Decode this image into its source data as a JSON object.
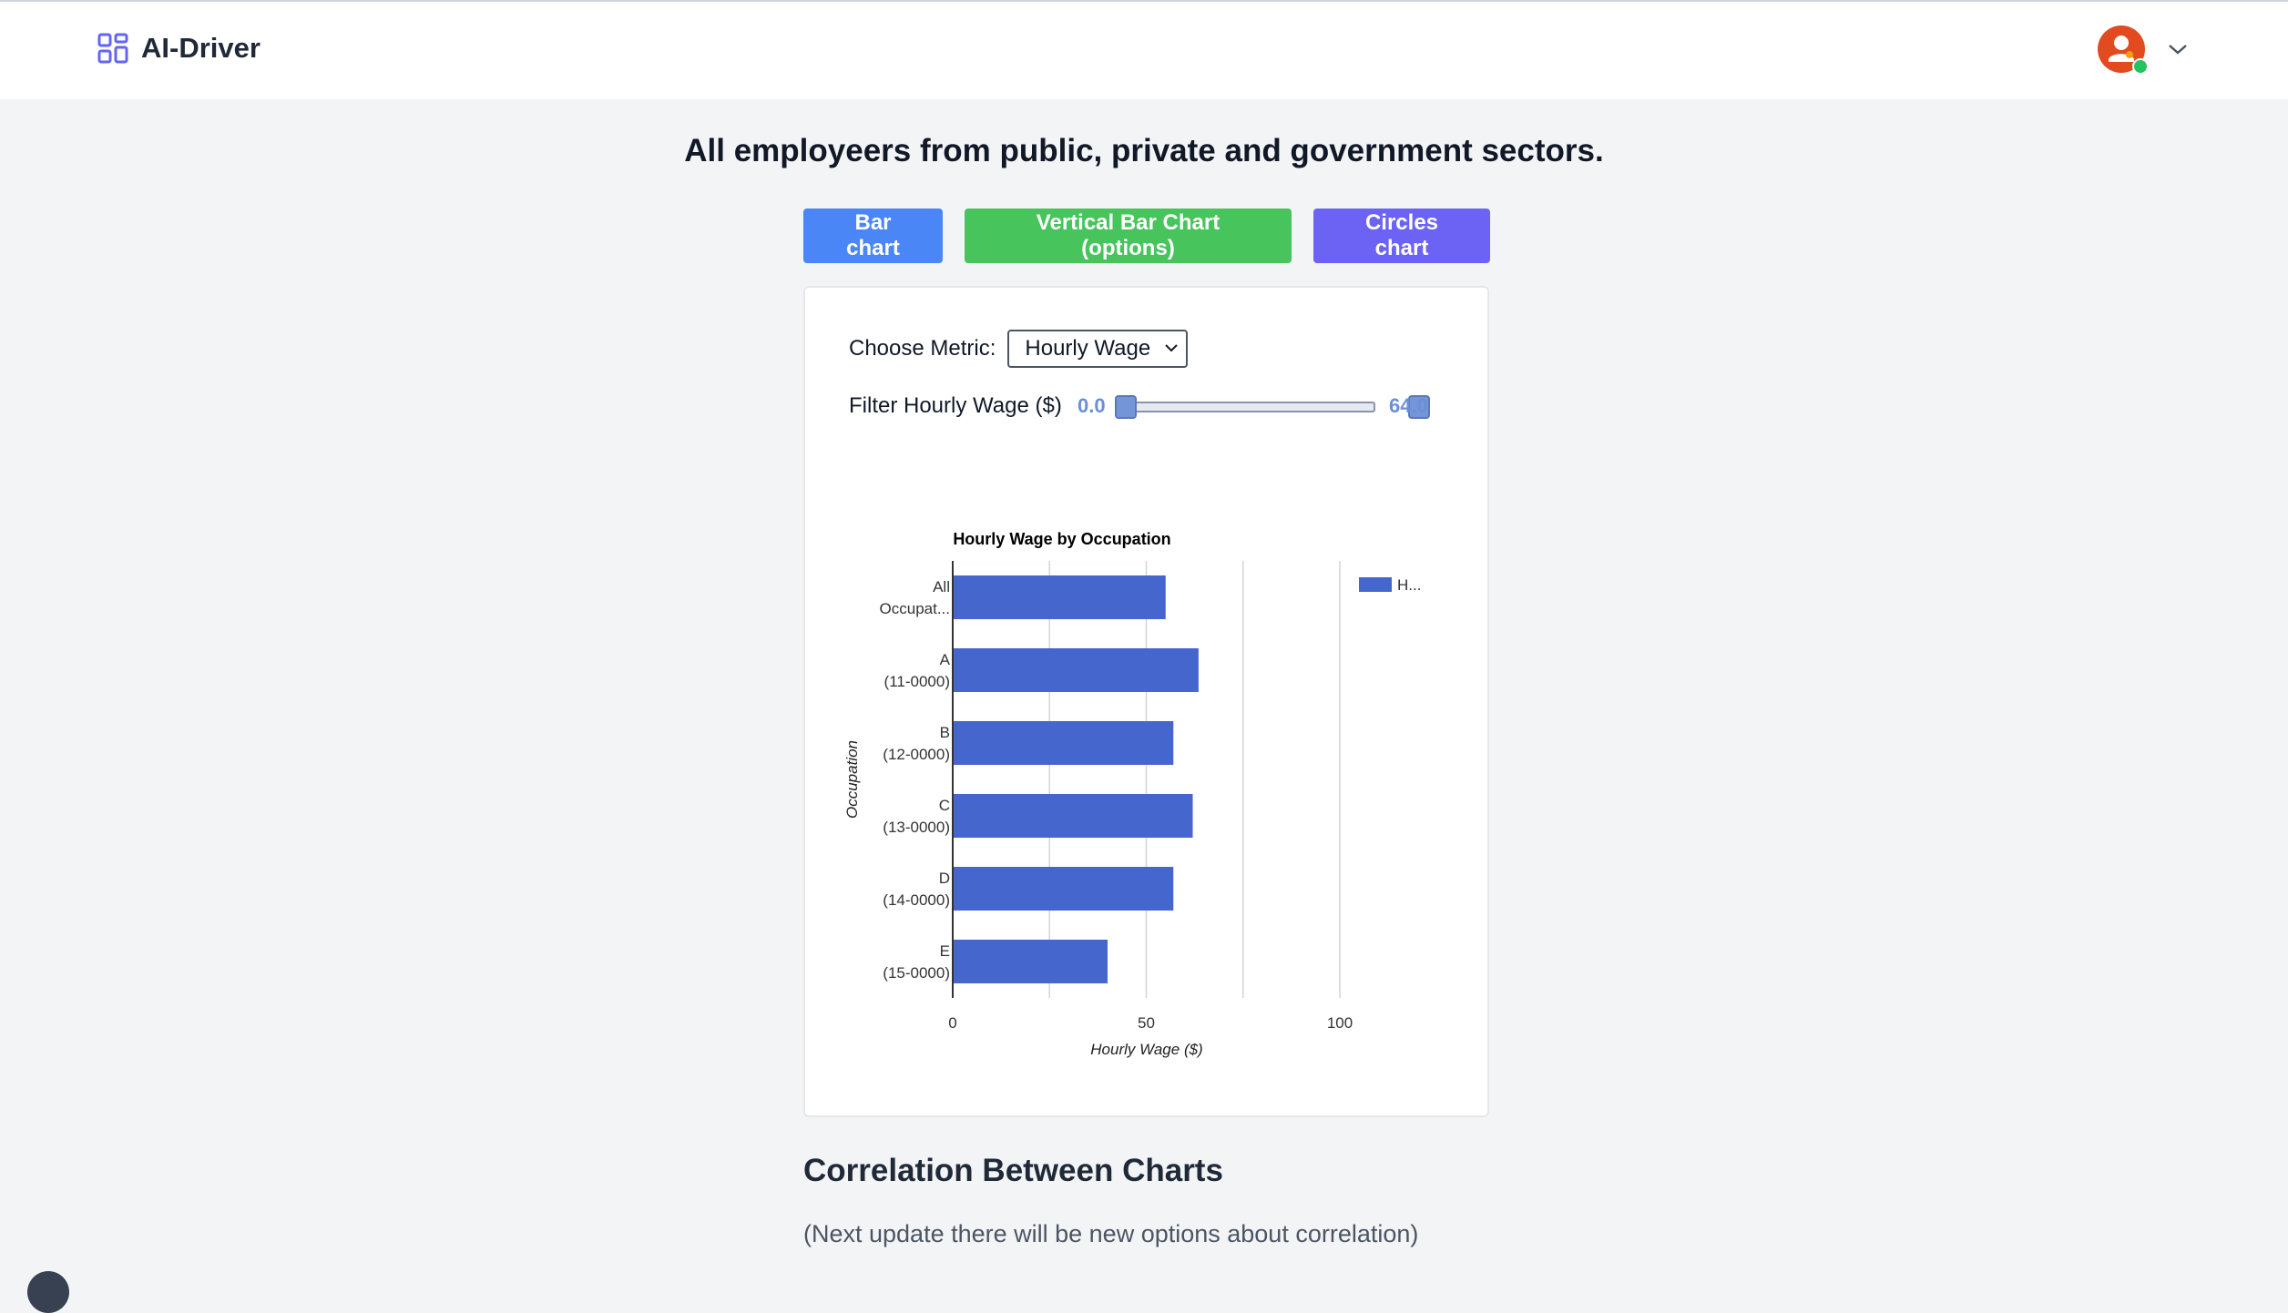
{
  "header": {
    "brand_name": "AI-Driver",
    "brand_icon": "grid-icon",
    "user_icon": "user-avatar-icon",
    "menu_icon": "chevron-down-icon",
    "status": "online"
  },
  "page": {
    "title": "All employeers from public, private and government sectors."
  },
  "chart_buttons": [
    {
      "label": "Bar chart",
      "color": "#4a86f5"
    },
    {
      "label": "Vertical Bar Chart (options)",
      "color": "#47c45c"
    },
    {
      "label": "Circles chart",
      "color": "#6c63f5"
    }
  ],
  "controls": {
    "metric_label": "Choose Metric:",
    "metric_selected": "Hourly Wage",
    "filter_label": "Filter Hourly Wage ($)",
    "range_min": "0.0",
    "range_max": "64.0"
  },
  "chart_data": {
    "type": "bar",
    "orientation": "horizontal",
    "title": "Hourly Wage by Occupation",
    "xlabel": "Hourly Wage ($)",
    "ylabel": "Occupation",
    "categories": [
      [
        "All",
        "Occupat..."
      ],
      [
        "A",
        "(11-0000)"
      ],
      [
        "B",
        "(12-0000)"
      ],
      [
        "C",
        "(13-0000)"
      ],
      [
        "D",
        "(14-0000)"
      ],
      [
        "E",
        "(15-0000)"
      ]
    ],
    "series": [
      {
        "name": "H...",
        "values": [
          55,
          63.5,
          57,
          62,
          57,
          40
        ],
        "color": "#4566cc"
      }
    ],
    "xlim": [
      0,
      100
    ],
    "xticks": [
      "0",
      "50",
      "100"
    ],
    "grid": true,
    "legend": "top-right"
  },
  "correlation": {
    "title": "Correlation Between Charts",
    "note": "(Next update there will be new options about correlation)"
  }
}
